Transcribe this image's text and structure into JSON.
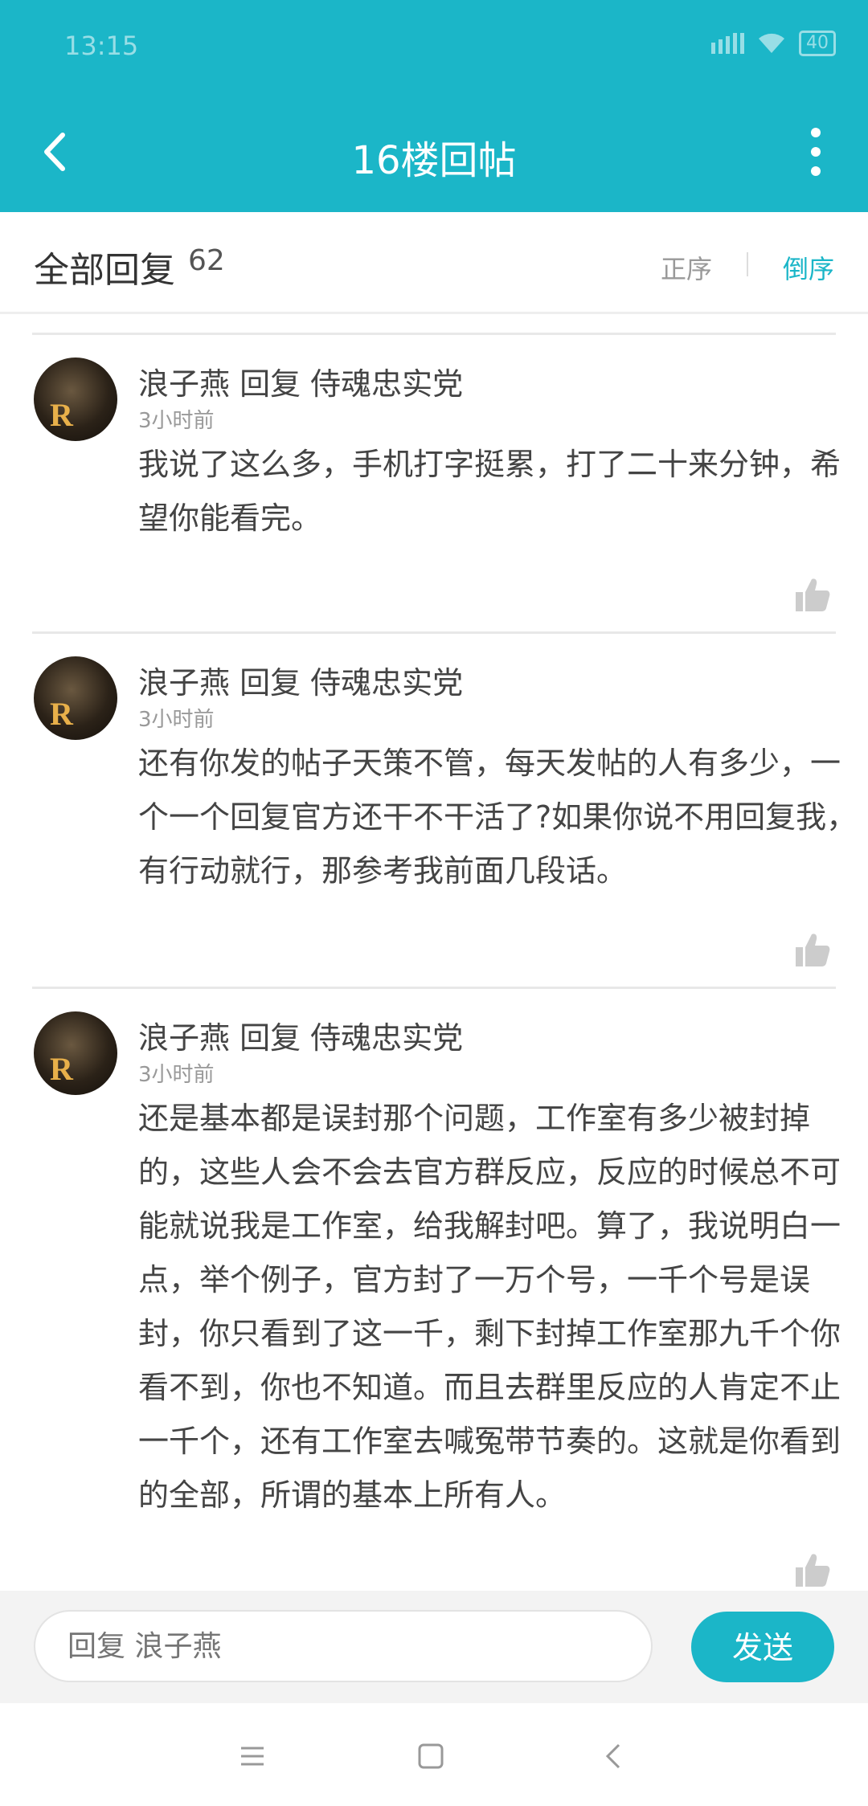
{
  "status_bar": {
    "time": "13:15",
    "battery": "40"
  },
  "app_bar": {
    "title": "16楼回帖",
    "back_icon": "chevron-left-icon",
    "more_icon": "more-vertical-icon"
  },
  "reply_header": {
    "label": "全部回复",
    "count": "62",
    "sort_asc": "正序",
    "sort_desc": "倒序",
    "active_sort": "倒序"
  },
  "comments": [
    {
      "author_line": "浪子燕 回复 侍魂忠实党",
      "time": "3小时前",
      "body": "我说了这么多，手机打字挺累，打了二十来分钟，希望你能看完。"
    },
    {
      "author_line": "浪子燕 回复 侍魂忠实党",
      "time": "3小时前",
      "body": "还有你发的帖子天策不管，每天发帖的人有多少，一个一个回复官方还干不干活了?如果你说不用回复我，有行动就行，那参考我前面几段话。"
    },
    {
      "author_line": "浪子燕 回复 侍魂忠实党",
      "time": "3小时前",
      "body": "还是基本都是误封那个问题，工作室有多少被封掉的，这些人会不会去官方群反应，反应的时候总不可能就说我是工作室，给我解封吧。算了，我说明白一点，举个例子，官方封了一万个号，一千个号是误封，你只看到了这一千，剩下封掉工作室那九千个你看不到，你也不知道。而且去群里反应的人肯定不止一千个，还有工作室去喊冤带节奏的。这就是你看到的全部，所谓的基本上所有人。"
    }
  ],
  "avatar_letter": "R",
  "input": {
    "placeholder": "回复 浪子燕",
    "send_label": "发送"
  },
  "colors": {
    "accent": "#1BB6C8",
    "text": "#444444",
    "muted": "#999999"
  }
}
